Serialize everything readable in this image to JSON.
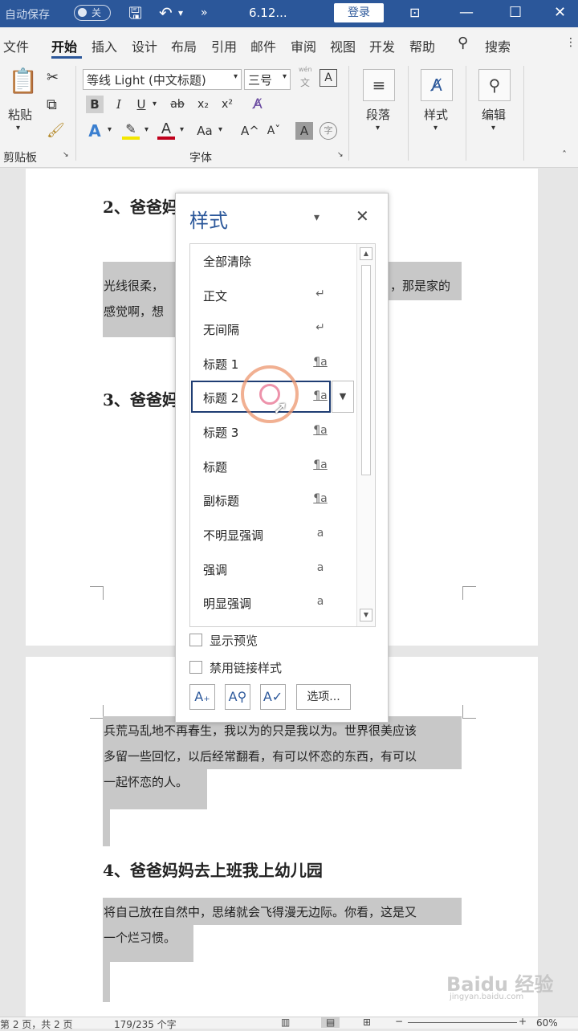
{
  "titlebar": {
    "autosave": "自动保存",
    "toggle_state": "关",
    "doc_title": "6.12...",
    "login": "登录"
  },
  "tabs": [
    "文件",
    "开始",
    "插入",
    "设计",
    "布局",
    "引用",
    "邮件",
    "审阅",
    "视图",
    "开发",
    "帮助",
    "搜索"
  ],
  "ribbon": {
    "paste": "粘贴",
    "clipboard_group": "剪贴板",
    "font_name": "等线 Light (中文标题)",
    "font_size": "三号",
    "font_group": "字体",
    "paragraph": "段落",
    "styles": "样式",
    "editing": "编辑",
    "wen": "wén",
    "wen_char": "文"
  },
  "document": {
    "heading2": "2、爸爸妈",
    "heading3": "3、爸爸妈",
    "para1_line1": "光线很柔，",
    "para1_line2": "感觉啊，想",
    "para1_right": "，那是家的",
    "para2_line1": "兵荒马乱地不再春生，我以为的只是我以为。世界很美应该",
    "para2_line2": "多留一些回忆，以后经常翻看，有可以怀恋的东西，有可以",
    "para2_line3": "一起怀恋的人。",
    "heading4": "4、爸爸妈妈去上班我上幼儿园",
    "para3_line1": "将自己放在自然中，思绪就会飞得漫无边际。你看，这是又",
    "para3_line2": "一个烂习惯。"
  },
  "styles_pane": {
    "title": "样式",
    "items": [
      {
        "name": "全部清除",
        "mark": ""
      },
      {
        "name": "正文",
        "mark": "↵"
      },
      {
        "name": "无间隔",
        "mark": "↵"
      },
      {
        "name": "标题 1",
        "mark": "¶a"
      },
      {
        "name": "标题 2",
        "mark": "¶a"
      },
      {
        "name": "标题 3",
        "mark": "¶a"
      },
      {
        "name": "标题",
        "mark": "¶a"
      },
      {
        "name": "副标题",
        "mark": "¶a"
      },
      {
        "name": "不明显强调",
        "mark": "a"
      },
      {
        "name": "强调",
        "mark": "a"
      },
      {
        "name": "明显强调",
        "mark": "a"
      }
    ],
    "show_preview": "显示预览",
    "disable_linked": "禁用链接样式",
    "options_btn": "选项..."
  },
  "statusbar": {
    "page": "第 2 页，共 2 页",
    "words": "179/235 个字",
    "zoom": "60%"
  },
  "watermark": {
    "brand": "Baidu 经验",
    "url": "jingyan.baidu.com"
  }
}
